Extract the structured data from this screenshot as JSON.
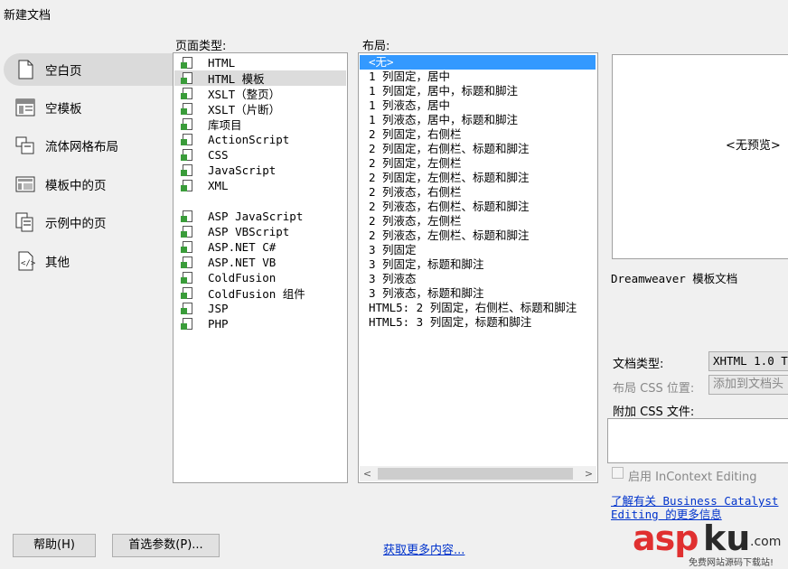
{
  "window": {
    "title": "新建文档"
  },
  "categories": [
    {
      "label": "空白页",
      "icon": "blank-page-icon",
      "selected": true
    },
    {
      "label": "空模板",
      "icon": "blank-template-icon"
    },
    {
      "label": "流体网格布局",
      "icon": "fluid-grid-icon"
    },
    {
      "label": "模板中的页",
      "icon": "template-page-icon"
    },
    {
      "label": "示例中的页",
      "icon": "sample-page-icon"
    },
    {
      "label": "其他",
      "icon": "other-code-icon"
    }
  ],
  "page_type": {
    "label": "页面类型:",
    "items": [
      "HTML",
      "HTML 模板",
      "XSLT（整页）",
      "XSLT（片断）",
      "库项目",
      "ActionScript",
      "CSS",
      "JavaScript",
      "XML",
      "ASP JavaScript",
      "ASP VBScript",
      "ASP.NET C#",
      "ASP.NET VB",
      "ColdFusion",
      "ColdFusion 组件",
      "JSP",
      "PHP"
    ],
    "selected_index": 1
  },
  "layout": {
    "label": "布局:",
    "items": [
      "<无>",
      "1 列固定，居中",
      "1 列固定，居中，标题和脚注",
      "1 列液态，居中",
      "1 列液态，居中，标题和脚注",
      "2 列固定，右侧栏",
      "2 列固定，右侧栏、标题和脚注",
      "2 列固定，左侧栏",
      "2 列固定，左侧栏、标题和脚注",
      "2 列液态，右侧栏",
      "2 列液态，右侧栏、标题和脚注",
      "2 列液态，左侧栏",
      "2 列液态，左侧栏、标题和脚注",
      "3 列固定",
      "3 列固定，标题和脚注",
      "3 列液态",
      "3 列液态，标题和脚注",
      "HTML5: 2 列固定，右侧栏、标题和脚注",
      "HTML5: 3 列固定，标题和脚注"
    ],
    "selected_index": 0
  },
  "preview": {
    "placeholder": "<无预览>",
    "description": "Dreamweaver 模板文档"
  },
  "options": {
    "doctype_label": "文档类型:",
    "doctype_value": "XHTML 1.0 T",
    "layout_css_label": "布局 CSS 位置:",
    "layout_css_value": "添加到文档头",
    "attach_css_label": "附加 CSS 文件:",
    "incontext_label": "启用 InContext Editing",
    "learn_more_line1": "了解有关 Business Catalyst",
    "learn_more_line2": "Editing 的更多信息"
  },
  "footer": {
    "help_button": "帮助(H)",
    "prefs_button": "首选参数(P)...",
    "more_content_link": "获取更多内容..."
  },
  "watermark": {
    "brand": "asp",
    "brand2": "ku",
    "suffix": ".com",
    "tagline": "免费网站源码下载站!"
  },
  "colors": {
    "selection": "#3399ff",
    "link": "#0033cc",
    "watermark_red": "#e03030"
  }
}
